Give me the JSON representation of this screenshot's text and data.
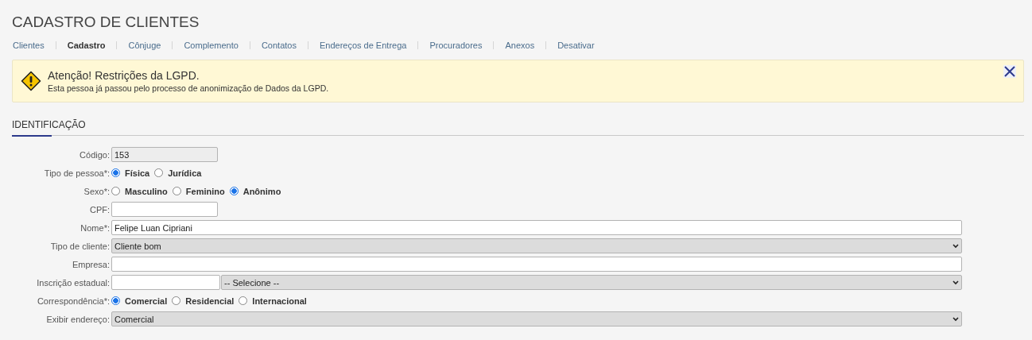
{
  "page": {
    "title": "CADASTRO DE CLIENTES"
  },
  "tabs": [
    {
      "label": "Clientes",
      "selected": false
    },
    {
      "label": "Cadastro",
      "selected": true
    },
    {
      "label": "Cônjuge",
      "selected": false
    },
    {
      "label": "Complemento",
      "selected": false
    },
    {
      "label": "Contatos",
      "selected": false
    },
    {
      "label": "Endereços de Entrega",
      "selected": false
    },
    {
      "label": "Procuradores",
      "selected": false
    },
    {
      "label": "Anexos",
      "selected": false
    },
    {
      "label": "Desativar",
      "selected": false
    }
  ],
  "alert": {
    "title": "Atenção! Restrições da LGPD.",
    "message": "Esta pessoa já passou pelo processo de anonimização de Dados da LGPD."
  },
  "section": {
    "title": "IDENTIFICAÇÃO"
  },
  "fields": [
    {
      "kind": "short-text",
      "label": "Código:",
      "value": "153",
      "readonly": true
    },
    {
      "kind": "radio",
      "label": "Tipo de pessoa*:",
      "options": [
        {
          "label": "Física",
          "selected": true
        },
        {
          "label": "Jurídica",
          "selected": false
        }
      ]
    },
    {
      "kind": "radio",
      "label": "Sexo*:",
      "options": [
        {
          "label": "Masculino",
          "selected": false
        },
        {
          "label": "Feminino",
          "selected": false
        },
        {
          "label": "Anônimo",
          "selected": true
        }
      ]
    },
    {
      "kind": "short-text",
      "label": "CPF:",
      "readonly": false
    },
    {
      "kind": "text",
      "label": "Nome*:",
      "value": "Felipe Luan Cipriani",
      "readonly": false
    },
    {
      "kind": "select",
      "label": "Tipo de cliente:",
      "value": "Cliente bom"
    },
    {
      "kind": "text",
      "label": "Empresa:",
      "readonly": false
    },
    {
      "kind": "text-select",
      "label": "Inscrição estadual:",
      "value": "-- Selecione --"
    },
    {
      "kind": "radio",
      "label": "Correspondência*:",
      "options": [
        {
          "label": "Comercial",
          "selected": true
        },
        {
          "label": "Residencial",
          "selected": false
        },
        {
          "label": "Internacional",
          "selected": false
        }
      ]
    },
    {
      "kind": "select",
      "label": "Exibir endereço:",
      "value": "Comercial"
    }
  ]
}
